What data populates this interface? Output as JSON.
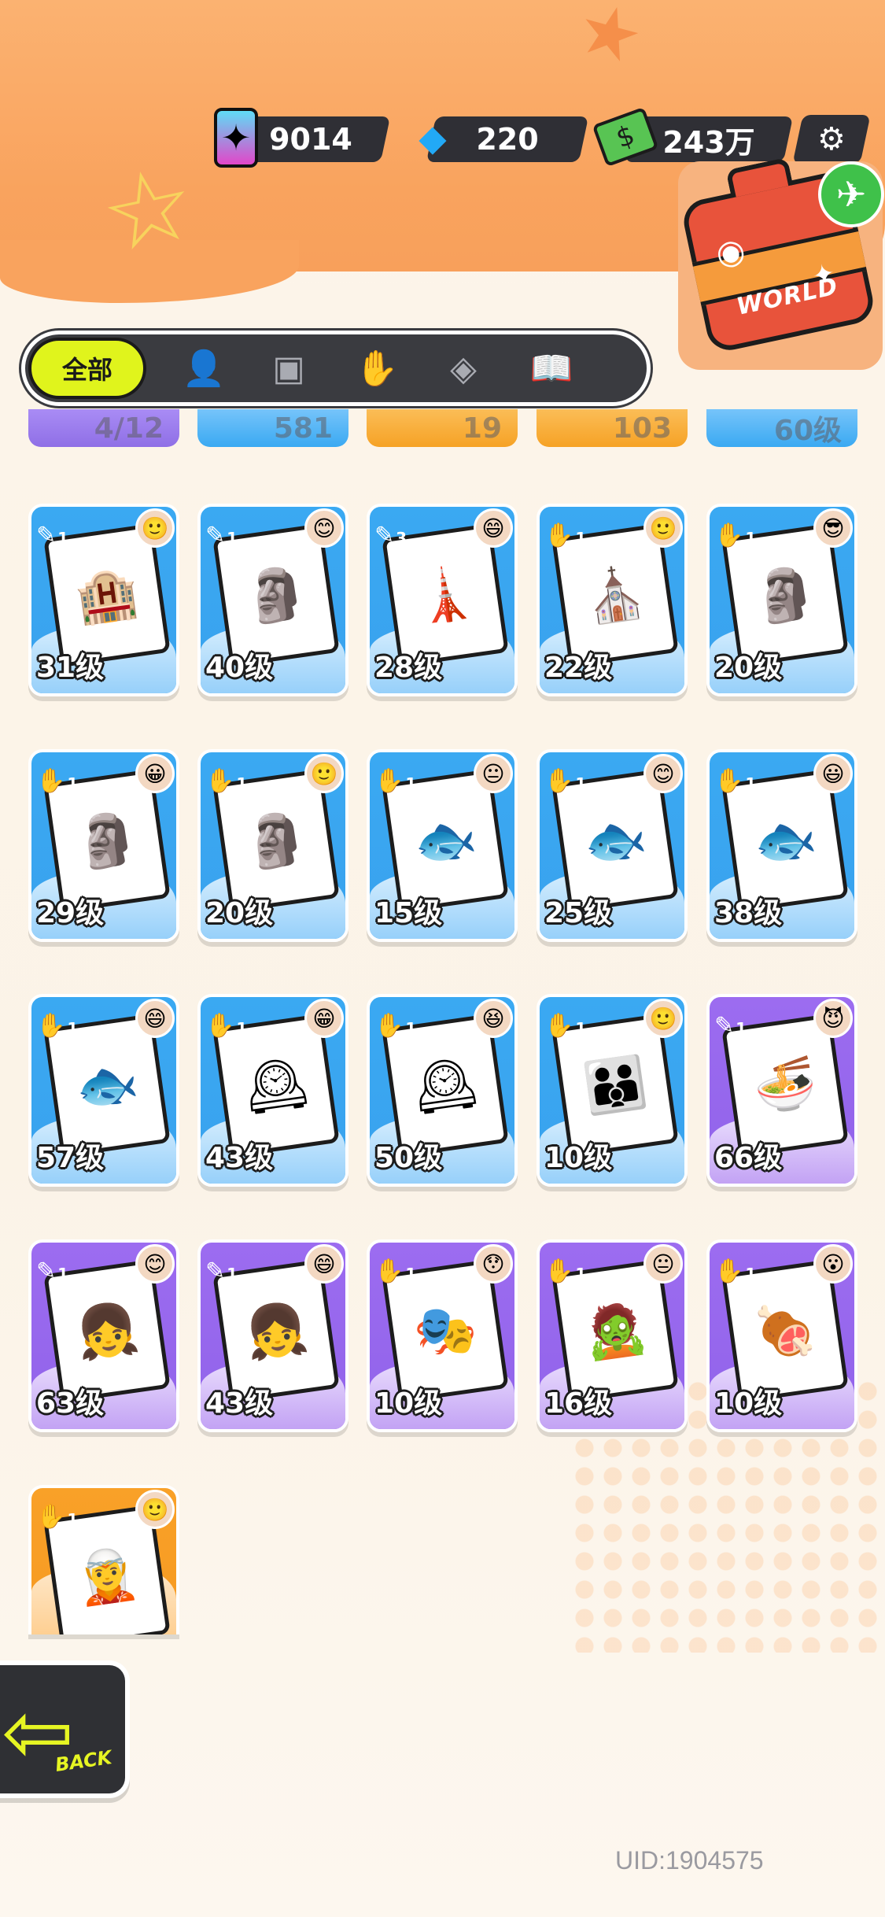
{
  "currency": {
    "paint": "9014",
    "gems": "220",
    "cash": "243万"
  },
  "icons": {
    "paint": "paint-can-icon",
    "gem": "diamond-icon",
    "cash": "money-icon",
    "settings": "gear-icon",
    "world": "suitcase-icon",
    "plane": "airplane-icon"
  },
  "world_button": {
    "label": "WORLD"
  },
  "filter_tabs": [
    {
      "label": "全部",
      "selected": true
    },
    {
      "icon": "person-icon"
    },
    {
      "icon": "box-icon"
    },
    {
      "icon": "hand-icon"
    },
    {
      "icon": "card-icon"
    },
    {
      "icon": "book-icon"
    }
  ],
  "strip_values": [
    "4/12",
    "581",
    "19",
    "103",
    "60级"
  ],
  "cards": [
    {
      "level": "31级",
      "color": "blue",
      "badge": "1"
    },
    {
      "level": "40级",
      "color": "blue",
      "badge": "1"
    },
    {
      "level": "28级",
      "color": "blue",
      "badge": "3"
    },
    {
      "level": "22级",
      "color": "blue",
      "badge": "1"
    },
    {
      "level": "20级",
      "color": "blue",
      "badge": "1"
    },
    {
      "level": "29级",
      "color": "blue",
      "badge": "1"
    },
    {
      "level": "20级",
      "color": "blue",
      "badge": "1"
    },
    {
      "level": "15级",
      "color": "blue",
      "badge": "1"
    },
    {
      "level": "25级",
      "color": "blue",
      "badge": "1"
    },
    {
      "level": "38级",
      "color": "blue",
      "badge": "1"
    },
    {
      "level": "57级",
      "color": "blue",
      "badge": "1"
    },
    {
      "level": "43级",
      "color": "blue",
      "badge": "1"
    },
    {
      "level": "50级",
      "color": "blue",
      "badge": "1"
    },
    {
      "level": "10级",
      "color": "blue",
      "badge": "1"
    },
    {
      "level": "66级",
      "color": "purple",
      "badge": "1"
    },
    {
      "level": "63级",
      "color": "purple",
      "badge": "1"
    },
    {
      "level": "43级",
      "color": "purple",
      "badge": "1"
    },
    {
      "level": "10级",
      "color": "purple",
      "badge": "1"
    },
    {
      "level": "16级",
      "color": "purple",
      "badge": "1"
    },
    {
      "level": "10级",
      "color": "purple",
      "badge": "1"
    },
    {
      "level": "",
      "color": "orange",
      "badge": "1"
    }
  ],
  "back_button": {
    "label": "BACK"
  },
  "uid": "UID:1904575"
}
